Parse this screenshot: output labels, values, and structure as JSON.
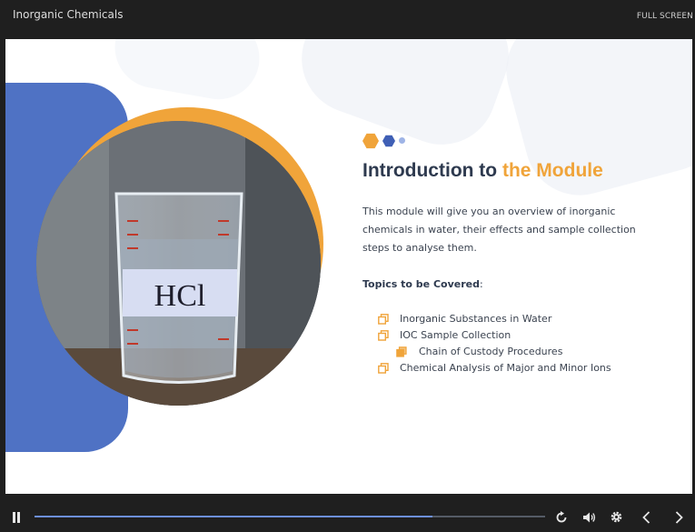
{
  "window": {
    "title": "Inorganic Chemicals",
    "fullscreen_label": "FULL SCREEN"
  },
  "slide": {
    "image_label": "HCl",
    "heading_prefix": "Introduction to ",
    "heading_accent": "the Module",
    "intro_text": "This module will give you an overview of inorganic chemicals in water, their effects and sample collection steps to analyse them.",
    "topics_label": "Topics to be Covered",
    "topics_label_suffix": ":",
    "topics": [
      {
        "label": "Inorganic Substances in Water"
      },
      {
        "label": "IOC Sample Collection"
      },
      {
        "label": "Chain of Custody Procedures"
      },
      {
        "label": "Chemical Analysis of Major and Minor Ions"
      }
    ]
  },
  "player": {
    "progress_percent": 78,
    "icons": [
      "pause-icon",
      "replay-icon",
      "volume-icon",
      "settings-icon",
      "previous-icon",
      "next-icon"
    ]
  },
  "colors": {
    "accent_orange": "#f0a43a",
    "brand_blue": "#4f72c4",
    "progress": "#6d8fe0"
  }
}
